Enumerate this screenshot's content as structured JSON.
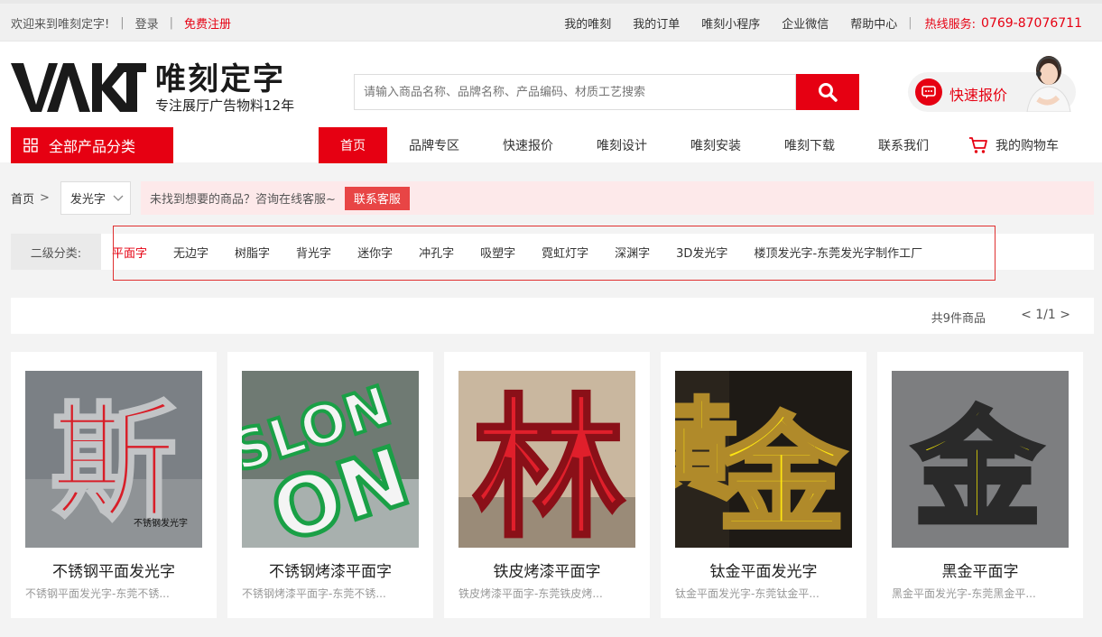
{
  "topbar": {
    "welcome": "欢迎来到唯刻定字!",
    "login": "登录",
    "register": "免费注册",
    "links": [
      "我的唯刻",
      "我的订单",
      "唯刻小程序",
      "企业微信",
      "帮助中心"
    ],
    "hotline_label": "热线服务:",
    "hotline_number": "0769-87076711"
  },
  "header": {
    "logo_text": "VAKT",
    "brand_name": "唯刻定字",
    "slogan": "专注展厅广告物料12年",
    "search_placeholder": "请输入商品名称、品牌名称、产品编码、材质工艺搜索",
    "quote_label": "快速报价"
  },
  "nav": {
    "all_categories": "全部产品分类",
    "items": [
      "首页",
      "品牌专区",
      "快速报价",
      "唯刻设计",
      "唯刻安装",
      "唯刻下载",
      "联系我们"
    ],
    "cart": "我的购物车"
  },
  "breadcrumb": {
    "home": "首页",
    "current": "发光字",
    "notice": "未找到想要的商品？咨询在线客服~",
    "contact_btn": "联系客服"
  },
  "subcategory": {
    "label": "二级分类:",
    "items": [
      "平面字",
      "无边字",
      "树脂字",
      "背光字",
      "迷你字",
      "冲孔字",
      "吸塑字",
      "霓虹灯字",
      "深渊字",
      "3D发光字",
      "楼顶发光字-东莞发光字制作工厂"
    ]
  },
  "results": {
    "count": "共9件商品",
    "pager": "< 1/1 >"
  },
  "products": [
    {
      "title": "不锈钢平面发光字",
      "desc": "不锈钢平面发光字-东莞不锈...",
      "img_char": "斯",
      "img_caption": "不锈钢发光字"
    },
    {
      "title": "不锈钢烤漆平面字",
      "desc": "不锈钢烤漆平面字-东莞不锈...",
      "img_char": "SLON",
      "img_caption": ""
    },
    {
      "title": "铁皮烤漆平面字",
      "desc": "铁皮烤漆平面字-东莞铁皮烤...",
      "img_char": "林",
      "img_caption": ""
    },
    {
      "title": "钛金平面发光字",
      "desc": "钛金平面发光字-东莞钛金平...",
      "img_char": "金",
      "img_caption": ""
    },
    {
      "title": "黑金平面字",
      "desc": "黑金平面发光字-东莞黑金平...",
      "img_char": "金",
      "img_caption": ""
    }
  ],
  "colors": {
    "accent": "#e60012",
    "notice_bg": "#fde9ea"
  }
}
